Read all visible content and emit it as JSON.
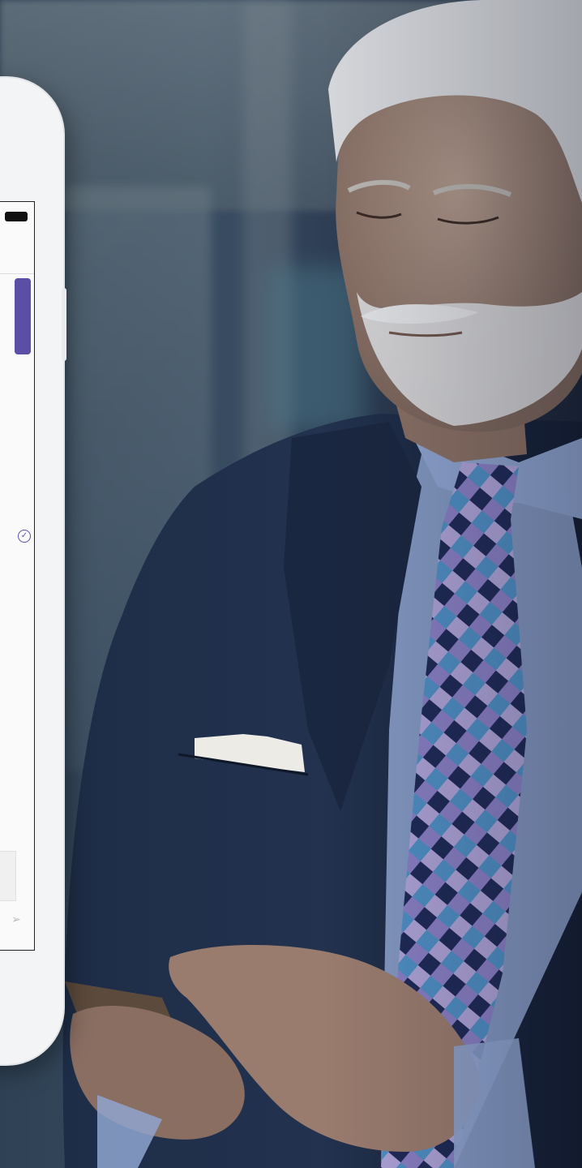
{
  "scene": {
    "description_icon": "businessman-using-phone",
    "colors": {
      "background": "#2f4154",
      "suit": "#1b2a44",
      "shirt": "#8fa4cf",
      "tie_purple": "#8a7fc4",
      "tie_blue": "#4f8fc4",
      "tie_navy": "#1f2a57",
      "skin": "#9c8478",
      "hair": "#d6d8dc",
      "phone_frame": "#f3f4f6",
      "accent": "#5a4fa5"
    }
  },
  "phone": {
    "icons": [
      "battery-icon",
      "check-circle-icon",
      "send-icon"
    ]
  }
}
